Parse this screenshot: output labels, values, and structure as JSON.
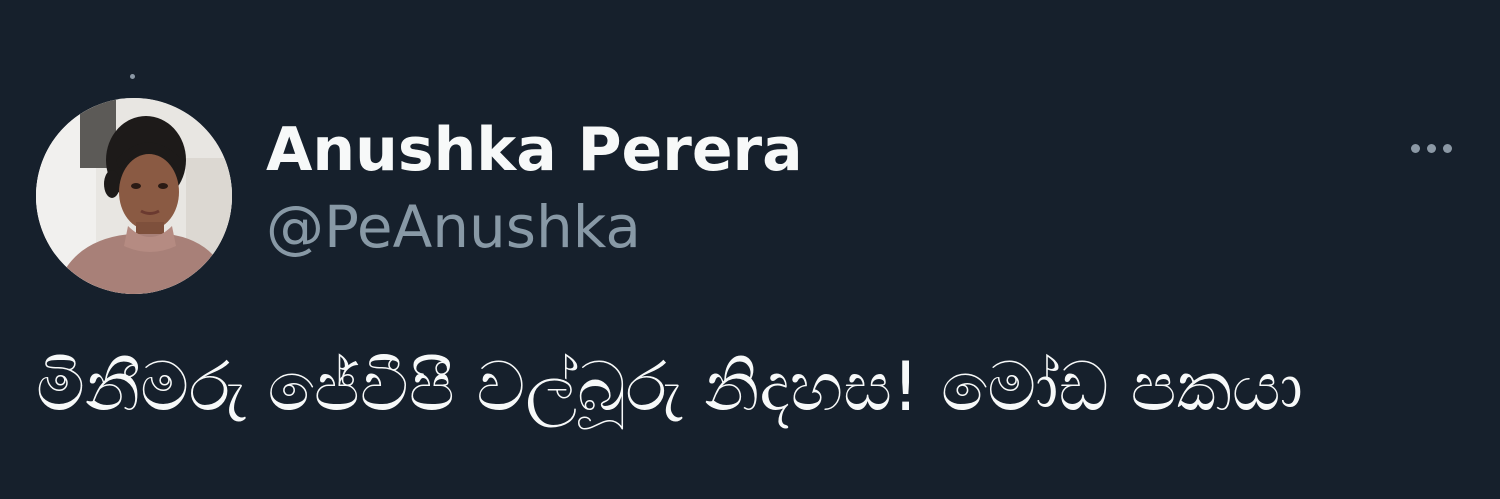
{
  "tweet": {
    "author": {
      "display_name": "Anushka Perera",
      "handle": "@PeAnushka",
      "avatar_icon": "profile-photo"
    },
    "text": "මිනීමරු ජේවීපී වල්බූරු නිදහස! මෝඩ පකයා",
    "more_icon": "more-horizontal-icon"
  },
  "colors": {
    "background": "#16202c",
    "name": "#f7f9f9",
    "handle": "#8899a6",
    "text": "#f7f9f9"
  }
}
